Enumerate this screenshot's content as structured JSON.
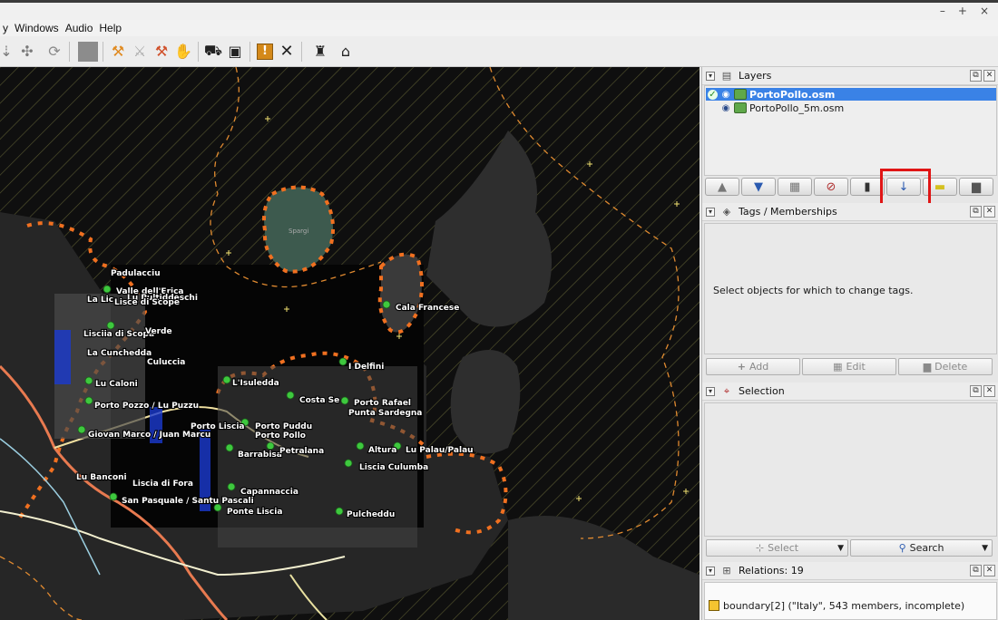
{
  "window": {
    "controls": [
      "–",
      "+",
      "×"
    ]
  },
  "menu": [
    "y",
    "Windows",
    "Audio",
    "Help"
  ],
  "toolbar_icons": [
    "download-icon",
    "share-icon",
    "refresh-icon",
    "gray-box-icon",
    "tool-a-icon",
    "tool-b-icon",
    "tool-c-icon",
    "hand-icon",
    "car-icon",
    "bus-icon",
    "warning-icon",
    "cross-icon",
    "castle-icon",
    "factory-icon"
  ],
  "map": {
    "labels": [
      "Padulacciu",
      "Valle dell'Erica",
      "La Lic",
      "Lu Pultiddeschi",
      "Lisce di Scope",
      "Lisciia di Scopa",
      "Verde",
      "La Cunchedda",
      "Culuccia",
      "Lu Caloni",
      "L'Isuledda",
      "Porto Pozzo / Lu Puzzu",
      "Costa Se",
      "Porto Rafael",
      "Punta Sardegna",
      "I Delfini",
      "Porto Liscia",
      "Porto Puddu",
      "Porto Pollo",
      "Giovan Marco / Juan Marcu",
      "Barrabisa",
      "Petralana",
      "Altura",
      "Lu Palau/Palau",
      "Liscia Culumba",
      "Lu Banconi",
      "Liscia di Fora",
      "Capannaccia",
      "San Pasquale / Santu Pascali",
      "Ponte Liscia",
      "Pulcheddu",
      "Cala Francese",
      "Spargi"
    ]
  },
  "layers_panel": {
    "title": "Layers",
    "layers": [
      {
        "name": "PortoPollo.osm",
        "active": true
      },
      {
        "name": "PortoPollo_5m.osm",
        "active": false
      }
    ]
  },
  "tags_panel": {
    "title": "Tags / Memberships",
    "empty_text": "Select objects for which to change tags.",
    "add": "Add",
    "edit": "Edit",
    "delete": "Delete"
  },
  "selection_panel": {
    "title": "Selection",
    "select": "Select",
    "search": "Search"
  },
  "relations_panel": {
    "title": "Relations: 19",
    "rows": [
      "boundary[2] (\"Italy\", 543 members, incomplete)"
    ]
  },
  "colors": {
    "highlight": "#3a82e6",
    "red_box": "#e01515"
  }
}
